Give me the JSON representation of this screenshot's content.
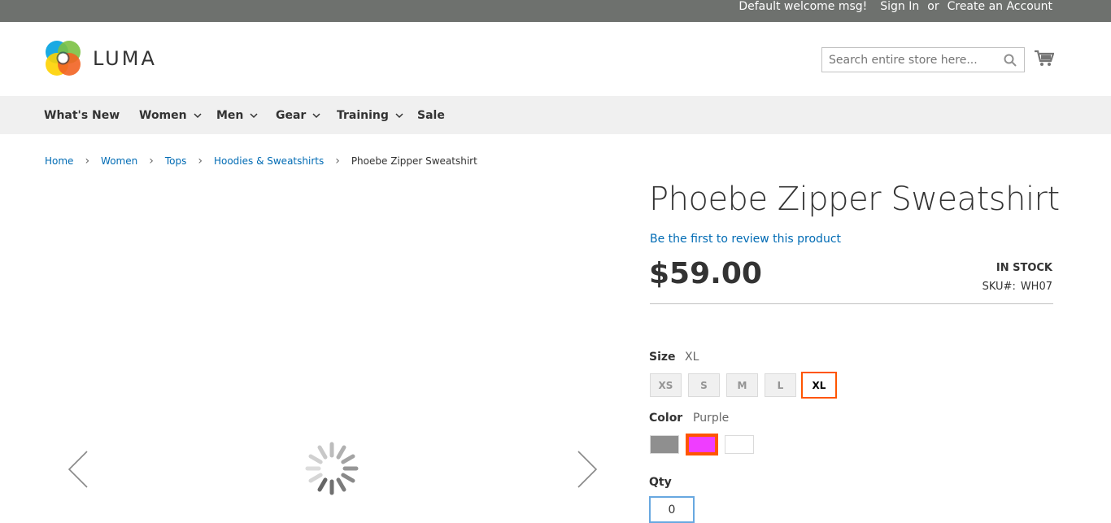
{
  "topbar": {
    "welcome": "Default welcome msg!",
    "sign_in": "Sign In",
    "or": "or",
    "create_account": "Create an Account"
  },
  "header": {
    "logo_text": "LUMA",
    "search_placeholder": "Search entire store here...",
    "search_value": ""
  },
  "nav": {
    "items": [
      {
        "label": "What's New",
        "has_dropdown": false
      },
      {
        "label": "Women",
        "has_dropdown": true
      },
      {
        "label": "Men",
        "has_dropdown": true
      },
      {
        "label": "Gear",
        "has_dropdown": true
      },
      {
        "label": "Training",
        "has_dropdown": true
      },
      {
        "label": "Sale",
        "has_dropdown": false
      }
    ]
  },
  "breadcrumbs": {
    "items": [
      "Home",
      "Women",
      "Tops",
      "Hoodies & Sweatshirts"
    ],
    "current": "Phoebe Zipper Sweatshirt"
  },
  "product": {
    "title": "Phoebe Zipper Sweatshirt",
    "review_link": "Be the first to review this product",
    "price": "$59.00",
    "stock": "IN STOCK",
    "sku_label": "SKU#:",
    "sku_value": "WH07"
  },
  "options": {
    "size_label": "Size",
    "size_selected": "XL",
    "sizes": [
      "XS",
      "S",
      "M",
      "L",
      "XL"
    ],
    "color_label": "Color",
    "color_selected": "Purple",
    "colors": [
      {
        "name": "Gray",
        "hex": "#8f8f8f"
      },
      {
        "name": "Purple",
        "hex": "#ef3dff"
      },
      {
        "name": "White",
        "hex": "#ffffff"
      }
    ]
  },
  "qty": {
    "label": "Qty",
    "value": "0"
  },
  "colors": {
    "accent": "#ff5501",
    "link": "#006bb4",
    "topbar_bg": "#6e716e",
    "nav_bg": "#f0f0f0"
  }
}
